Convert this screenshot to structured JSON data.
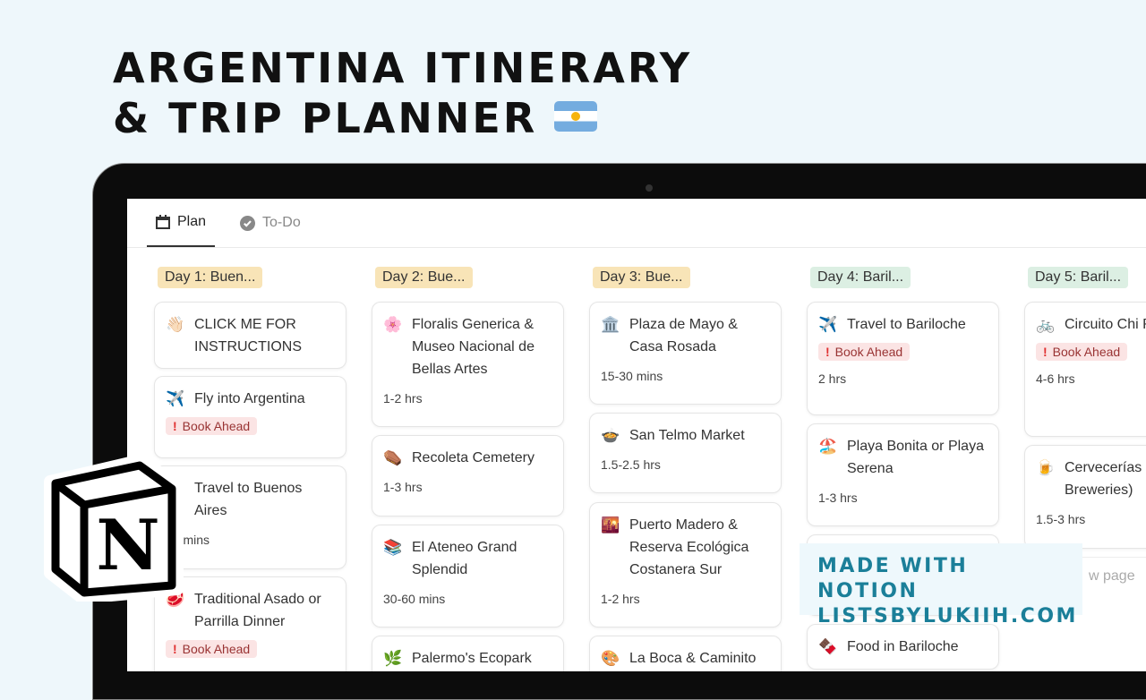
{
  "title_lines": [
    "ARGENTINA ITINERARY",
    "& TRIP PLANNER"
  ],
  "tabs": [
    {
      "label": "Plan",
      "icon": "calendar-icon"
    },
    {
      "label": "To-Do",
      "icon": "check-circle-icon"
    }
  ],
  "columns": [
    {
      "label": "Day 1: Buen...",
      "color": "#f8e4b7",
      "cards": [
        {
          "icon": "👋🏻",
          "title": "CLICK ME FOR INSTRUCTIONS"
        },
        {
          "icon": "✈️",
          "title": "Fly into Argentina",
          "badge": "Book Ahead"
        },
        {
          "icon": "🚗",
          "title": "Travel to Buenos Aires",
          "duration": "60 mins"
        },
        {
          "icon": "🥩",
          "title": "Traditional Asado or Parrilla Dinner",
          "badge": "Book Ahead"
        }
      ]
    },
    {
      "label": "Day 2: Bue...",
      "color": "#f8e4b7",
      "cards": [
        {
          "icon": "🌸",
          "title": "Floralis Generica & Museo Nacional de Bellas Artes",
          "duration": "1-2 hrs"
        },
        {
          "icon": "⚰️",
          "title": "Recoleta Cemetery",
          "duration": "1-3 hrs"
        },
        {
          "icon": "📚",
          "title": "El Ateneo Grand Splendid",
          "duration": "30-60 mins"
        },
        {
          "icon": "🌿",
          "title": "Palermo's Ecopark"
        }
      ]
    },
    {
      "label": "Day 3: Bue...",
      "color": "#f8e4b7",
      "cards": [
        {
          "icon": "🏛️",
          "title": "Plaza de Mayo & Casa Rosada",
          "duration": "15-30 mins"
        },
        {
          "icon": "🍲",
          "title": "San Telmo Market",
          "duration": "1.5-2.5 hrs"
        },
        {
          "icon": "🌇",
          "title": "Puerto Madero & Reserva Ecológica Costanera Sur",
          "duration": "1-2 hrs"
        },
        {
          "icon": "🎨",
          "title": "La Boca & Caminito"
        }
      ]
    },
    {
      "label": "Day 4: Baril...",
      "color": "#dcefe3",
      "cards": [
        {
          "icon": "✈️",
          "title": "Travel to Bariloche",
          "badge": "Book Ahead",
          "duration": "2 hrs"
        },
        {
          "icon": "🏖️",
          "title": "Playa Bonita or Playa Serena",
          "duration": "1-3 hrs"
        },
        {
          "icon": "",
          "title": ""
        },
        {
          "icon": "🍫",
          "title": "Food in Bariloche"
        }
      ]
    },
    {
      "label": "Day 5: Baril...",
      "color": "#dcefe3",
      "cards": [
        {
          "icon": "🚲",
          "title": "Circuito Chi Ride",
          "badge": "Book Ahead",
          "duration": "4-6 hrs"
        },
        {
          "icon": "🍺",
          "title": "Cervecerías Breweries)",
          "duration": "1.5-3 hrs"
        }
      ],
      "new_page": "w page"
    }
  ],
  "watermark": [
    "MADE WITH NOTION",
    "LISTSBYLUKIIH.COM"
  ],
  "colors": {
    "badge_bg": "#fbe4e4",
    "brand": "#1b7f99"
  }
}
